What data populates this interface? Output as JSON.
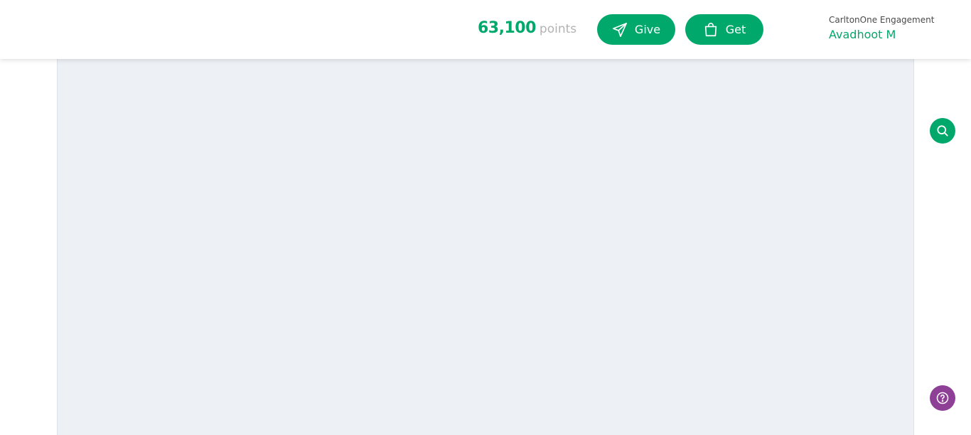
{
  "header": {
    "points": {
      "value": "63,100",
      "unit": "points"
    },
    "give_button": {
      "label": "Give",
      "icon": "paper-plane-icon"
    },
    "get_button": {
      "label": "Get",
      "icon": "shopping-bag-icon"
    },
    "user": {
      "organization": "CarltonOne Engagement",
      "name": "Avadhoot M"
    }
  },
  "floating_actions": {
    "search": {
      "icon": "search-icon"
    },
    "help": {
      "icon": "help-icon"
    }
  },
  "colors": {
    "brand_green": "#00a86b",
    "help_purple": "#8e3f96",
    "content_background": "#edf1f5"
  }
}
